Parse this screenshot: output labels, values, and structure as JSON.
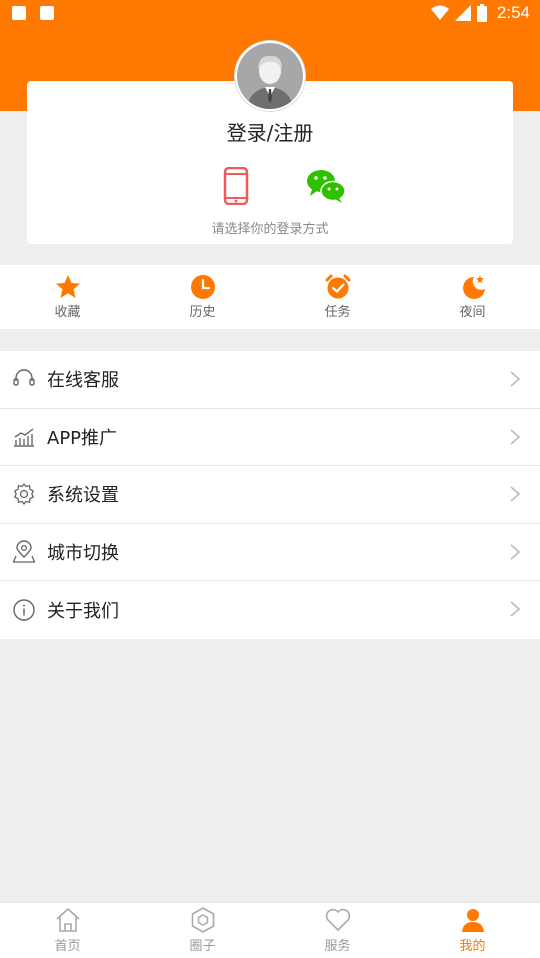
{
  "status_bar": {
    "time": "2:54"
  },
  "login_card": {
    "title": "登录/注册",
    "hint": "请选择你的登录方式",
    "methods": [
      "phone-icon",
      "wechat-icon"
    ]
  },
  "quick_actions": [
    {
      "label": "收藏",
      "icon": "star-icon"
    },
    {
      "label": "历史",
      "icon": "clock-icon"
    },
    {
      "label": "任务",
      "icon": "alarm-icon"
    },
    {
      "label": "夜间",
      "icon": "moon-icon"
    }
  ],
  "menu": [
    {
      "label": "在线客服",
      "icon": "headset-icon"
    },
    {
      "label": "APP推广",
      "icon": "chart-icon"
    },
    {
      "label": "系统设置",
      "icon": "gear-icon"
    },
    {
      "label": "城市切换",
      "icon": "location-icon"
    },
    {
      "label": "关于我们",
      "icon": "info-icon"
    }
  ],
  "tabbar": [
    {
      "label": "首页",
      "icon": "home-icon"
    },
    {
      "label": "圈子",
      "icon": "hexagon-icon"
    },
    {
      "label": "服务",
      "icon": "heart-icon"
    },
    {
      "label": "我的",
      "icon": "user-icon",
      "active": true
    }
  ],
  "colors": {
    "accent": "#ff7800",
    "background": "#eeeeee"
  }
}
